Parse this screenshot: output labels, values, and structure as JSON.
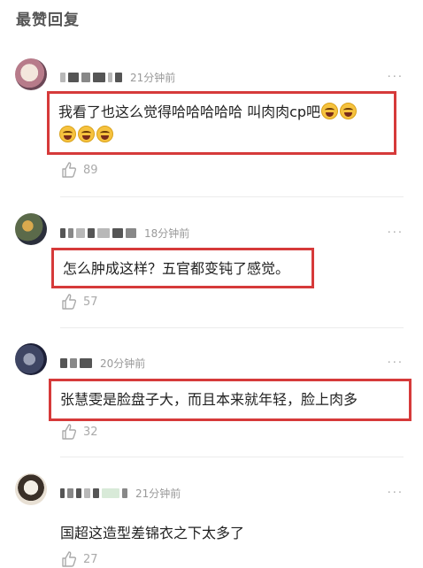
{
  "section": {
    "title": "最赞回复"
  },
  "more_label": "···",
  "comments": [
    {
      "time": "21分钟前",
      "text": "我看了也这么觉得哈哈哈哈哈 叫肉肉cp吧",
      "likes": "89",
      "emoji_count_line1": 2,
      "emoji_count_line2": 3
    },
    {
      "time": "18分钟前",
      "text": "怎么肿成这样？五官都变钝了感觉。",
      "likes": "57"
    },
    {
      "time": "20分钟前",
      "text": "张慧雯是脸盘子大，而且本来就年轻，脸上肉多",
      "likes": "32"
    },
    {
      "time": "21分钟前",
      "text": "国超这造型差锦衣之下太多了",
      "likes": "27"
    }
  ],
  "colors": {
    "highlight_border": "#d63a3a",
    "muted": "#999999"
  },
  "icons": {
    "like": "thumbs-up-icon",
    "more": "more-dots-icon",
    "emoji": "laugh-cry-emoji-icon"
  }
}
